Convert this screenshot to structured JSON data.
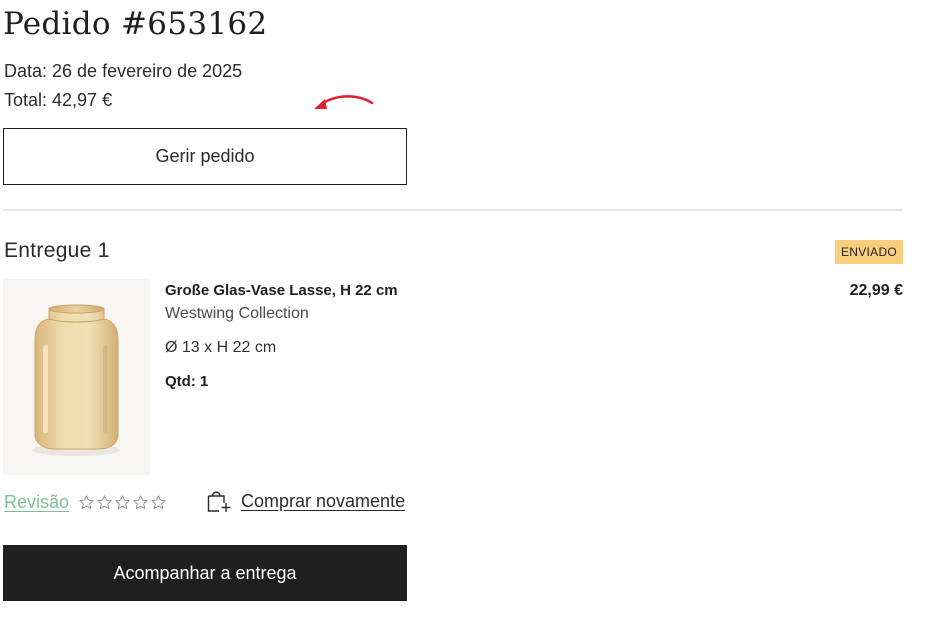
{
  "order": {
    "title": "Pedido #653162",
    "date": "Data: 26 de fevereiro de 2025",
    "total": "Total: 42,97 €",
    "manage_button": "Gerir pedido"
  },
  "shipment": {
    "title": "Entregue 1",
    "status_badge": "ENVIADO",
    "item": {
      "name": "Große Glas-Vase Lasse, H 22 cm",
      "brand": "Westwing Collection",
      "dimensions": "Ø 13 x H 22 cm",
      "quantity": "Qtd: 1",
      "price": "22,99 €"
    },
    "review_label": "Revisão",
    "buy_again_label": "Comprar novamente",
    "track_button": "Acompanhar a entrega"
  },
  "rating": {
    "max": 5,
    "value": 0
  },
  "icons": {
    "annotation": "red-arrow-icon",
    "stars": "star-outline-icon",
    "buy_again": "shopping-bag-plus-icon"
  },
  "colors": {
    "badge": "#f7cf7d",
    "review_link": "#7cbf99",
    "dark_button": "#1f1f1f",
    "annotation_arrow": "#e0202a"
  }
}
